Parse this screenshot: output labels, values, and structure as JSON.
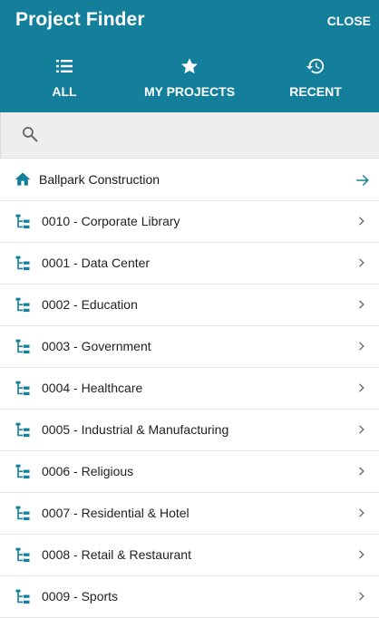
{
  "header": {
    "title": "Project Finder",
    "close_label": "CLOSE",
    "tabs": [
      {
        "label": "ALL",
        "icon": "list-icon"
      },
      {
        "label": "MY PROJECTS",
        "icon": "star-icon"
      },
      {
        "label": "RECENT",
        "icon": "history-icon"
      }
    ]
  },
  "search": {
    "placeholder": "",
    "value": "",
    "icon": "search-icon"
  },
  "company": {
    "name": "Ballpark Construction",
    "icon": "home-icon",
    "action_icon": "arrow-right-icon"
  },
  "projects": [
    "0010 - Corporate Library",
    "0001 - Data Center",
    "0002 - Education",
    "0003 - Government",
    "0004 - Healthcare",
    "0005 - Industrial & Manufacturing",
    "0006 - Religious",
    "0007 - Residential & Hotel",
    "0008 - Retail & Restaurant",
    "0009 - Sports"
  ],
  "colors": {
    "accent": "#137f9a",
    "search_bg": "#eeeeee"
  }
}
